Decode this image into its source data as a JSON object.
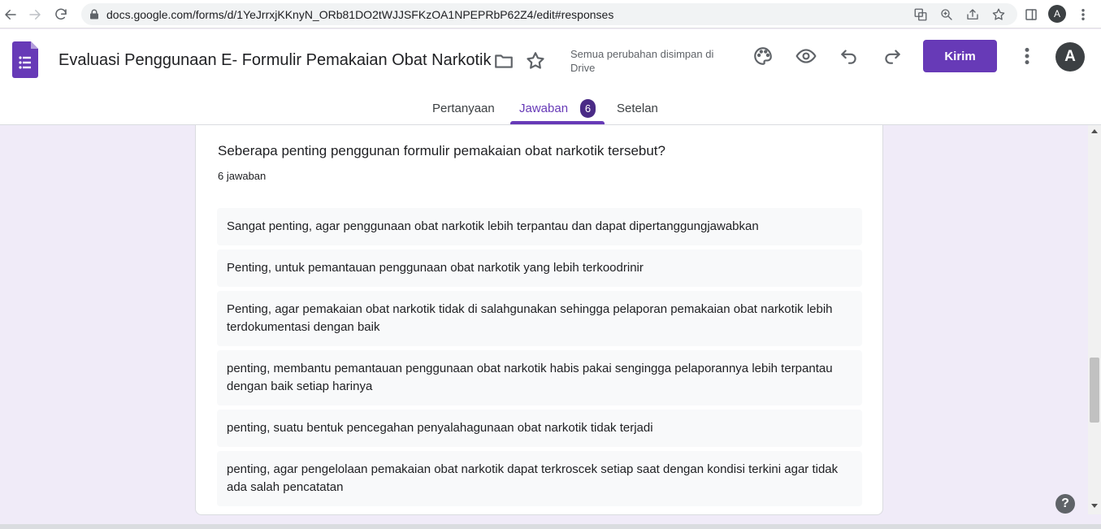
{
  "browser": {
    "url": "docs.google.com/forms/d/1YeJrrxjKKnyN_ORb81DO2tWJJSFKzOA1NPEPRbP62Z4/edit#responses",
    "profile_initial": "A"
  },
  "header": {
    "title": "Evaluasi Penggunaan E- Formulir Pemakaian Obat Narkotik",
    "save_status": "Semua perubahan disimpan di Drive",
    "send_label": "Kirim",
    "avatar_initial": "A"
  },
  "tabs": [
    {
      "label": "Pertanyaan"
    },
    {
      "label": "Jawaban",
      "badge": "6",
      "active": true
    },
    {
      "label": "Setelan"
    }
  ],
  "question": {
    "title": "Seberapa penting penggunan formulir pemakaian obat narkotik tersebut?",
    "count": "6 jawaban",
    "responses": [
      "Sangat penting, agar penggunaan obat narkotik lebih terpantau dan dapat dipertanggungjawabkan",
      "Penting, untuk pemantauan penggunaan obat narkotik yang lebih terkoodrinir",
      "Penting, agar pemakaian obat narkotik tidak di salahgunakan sehingga pelaporan pemakaian obat narkotik lebih terdokumentasi dengan baik",
      "penting, membantu pemantauan penggunaan obat narkotik habis pakai sengingga pelaporannya lebih terpantau dengan baik setiap harinya",
      "penting, suatu bentuk pencegahan penyalahagunaan obat narkotik tidak terjadi",
      "penting, agar pengelolaan pemakaian obat narkotik dapat terkroscek setiap saat dengan kondisi terkini agar tidak ada salah pencatatan"
    ]
  },
  "help_label": "?",
  "colors": {
    "accent": "#673ab7",
    "background": "#f0ebf8"
  }
}
